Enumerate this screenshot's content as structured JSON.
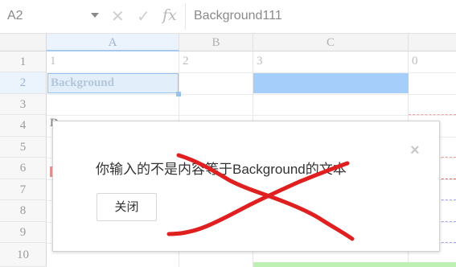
{
  "formula_bar": {
    "cell_ref": "A2",
    "cancel_icon": "✕",
    "confirm_icon": "✓",
    "fx_label": "fx",
    "formula": "Background111"
  },
  "grid": {
    "columns": [
      "A",
      "B",
      "C"
    ],
    "rows": [
      "1",
      "2",
      "3",
      "4",
      "5",
      "6",
      "7",
      "8",
      "9",
      "10"
    ],
    "row1": {
      "a": "1",
      "b": "2",
      "c": "3",
      "d": "0"
    },
    "a2_value": "Background",
    "r4_fragment": "D..."
  },
  "dialog": {
    "message": "你输入的不是内容等于Background的文本",
    "close_icon": "×",
    "close_button": "关闭"
  },
  "colors": {
    "selection_fill": "#e3eefb",
    "c2_fill": "#a5cffa",
    "scribble": "#e02020"
  }
}
